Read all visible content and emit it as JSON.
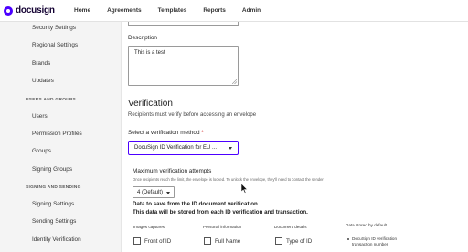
{
  "brand": {
    "logo_text": "docusign"
  },
  "nav": {
    "items": [
      "Home",
      "Agreements",
      "Templates",
      "Reports",
      "Admin"
    ]
  },
  "sidebar": {
    "items_a": [
      "Security Settings",
      "Regional Settings",
      "Brands",
      "Updates"
    ],
    "head_users": "USERS AND GROUPS",
    "items_b": [
      "Users",
      "Permission Profiles",
      "Groups",
      "Signing Groups"
    ],
    "head_signing": "SIGNING AND SENDING",
    "items_c": [
      "Signing Settings",
      "Sending Settings",
      "Identity Verification"
    ]
  },
  "form": {
    "description_label": "Description",
    "description_value": "This is a test",
    "verification_title": "Verification",
    "verification_sub": "Recipients must verify before accessing an envelope",
    "method_label": "Select a verification method",
    "method_required": "*",
    "method_value": "DocuSign ID Verification for EU ...",
    "max_attempts_label": "Maximum verification attempts",
    "max_attempts_hint": "Once recipients reach the limit, the envelope is locked. To unlock the envelope, they'll need to contact the sender.",
    "max_attempts_value": "4 (Default)",
    "save_data_title": "Data to save from the ID document verification",
    "save_data_note": "This data will be stored from each ID verification and transaction.",
    "col_images": "Images captures",
    "col_personal": "Personal information",
    "col_document": "Document details",
    "col_stored": "Data stored by default",
    "cb_front": "Front of ID",
    "cb_fullname": "Full Name",
    "cb_type": "Type of ID",
    "stored_item": "DocuSign ID verification transaction number"
  }
}
